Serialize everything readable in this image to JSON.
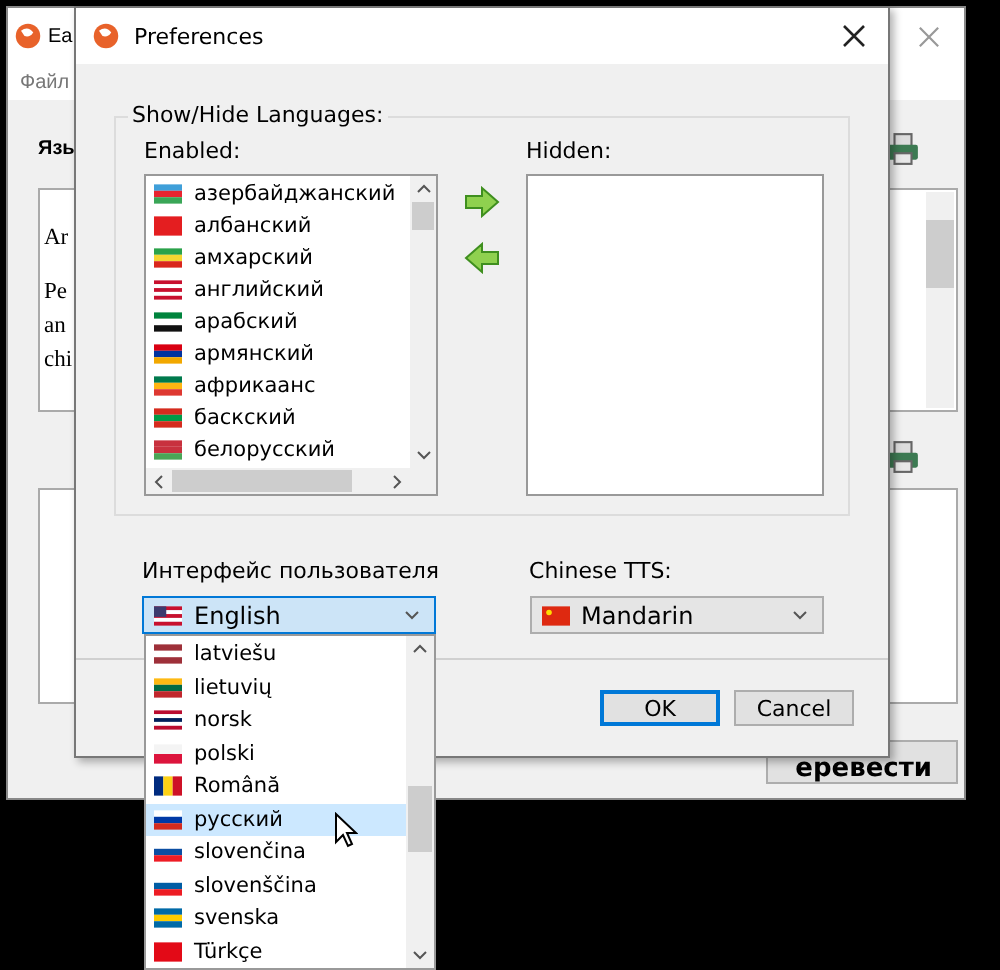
{
  "main_window": {
    "title": "Ea",
    "menu": [
      "Файл"
    ],
    "section_label": "Язы",
    "text_lines": [
      "Ar",
      "Pe",
      "an",
      "chi"
    ],
    "translate_button": "еревести"
  },
  "dialog": {
    "title": "Preferences",
    "group_title": "Show/Hide Languages:",
    "enabled_label": "Enabled:",
    "enabled_items": [
      "азербайджанский",
      "албанский",
      "амхарский",
      "английский",
      "арабский",
      "армянский",
      "африкаанс",
      "баскский",
      "белорусский"
    ],
    "hidden_label": "Hidden:",
    "ui_label": "Интерфейс пользователя",
    "ui_value": "English",
    "tts_label": "Chinese TTS:",
    "tts_value": "Mandarin",
    "buttons": [
      {
        "label": "OK",
        "default": true
      },
      {
        "label": "Cancel",
        "default": false
      }
    ]
  },
  "dropdown": {
    "items": [
      {
        "label": "latviešu",
        "selected": false
      },
      {
        "label": "lietuvių",
        "selected": false
      },
      {
        "label": "norsk",
        "selected": false
      },
      {
        "label": "polski",
        "selected": false
      },
      {
        "label": "Română",
        "selected": false
      },
      {
        "label": "русский",
        "selected": true
      },
      {
        "label": "slovenčina",
        "selected": false
      },
      {
        "label": "slovenščina",
        "selected": false
      },
      {
        "label": "svenska",
        "selected": false
      },
      {
        "label": "Türkçe",
        "selected": false
      }
    ]
  }
}
